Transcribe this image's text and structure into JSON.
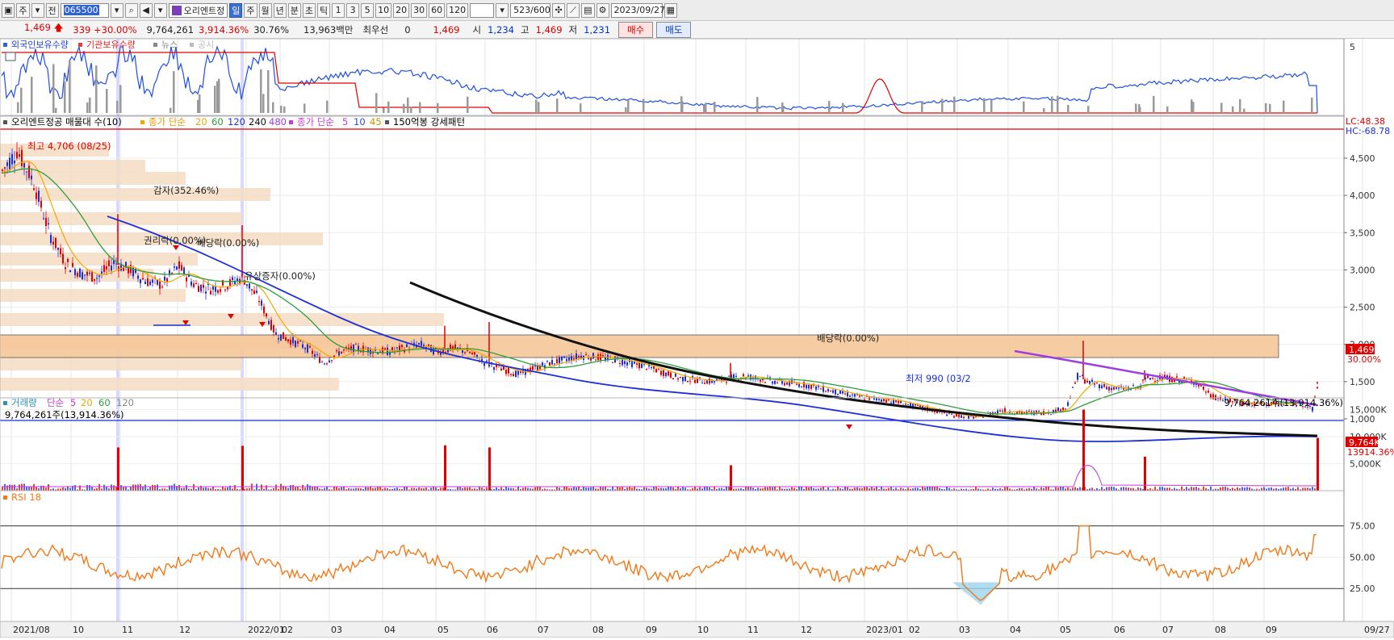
{
  "toolbar": {
    "market_label": "주",
    "period_label": "전",
    "code": "065500",
    "stock_name": "오리엔트정",
    "periods": [
      "일",
      "주",
      "월",
      "년",
      "분",
      "초",
      "틱"
    ],
    "selected_period": "일",
    "intervals": [
      "1",
      "3",
      "5",
      "10",
      "20",
      "30",
      "60",
      "120"
    ],
    "count": "523/600",
    "date": "2023/09/27"
  },
  "info": {
    "price": "1,469",
    "change": "339 +30.00%",
    "volume": "9,764,261",
    "volume_ratio": "3,914.36%",
    "turnover": "30.76%",
    "amount": "13,963백만",
    "priority_label": "최우선",
    "priority_value": "0",
    "priority_price": "1,469",
    "open_label": "시",
    "open": "1,234",
    "high_label": "고",
    "high": "1,469",
    "low_label": "저",
    "low": "1,231",
    "buy_label": "매수",
    "sell_label": "매도"
  },
  "panels": {
    "top_legend": [
      "외국인보유수량",
      "기관보유수량",
      "뉴스",
      "공시"
    ],
    "top_axis": "5",
    "price_legend": {
      "name": "오리엔트정공 매물대 수(10)",
      "ma_close_label": "종가 단순",
      "ma_close": [
        "20",
        "60",
        "120",
        "240",
        "480"
      ],
      "ma_close2_label": "종가 단순",
      "ma_close2": [
        "5",
        "10",
        "45"
      ],
      "pattern": "150억봉 강세패턴"
    },
    "price_axis": [
      "4,500",
      "4,000",
      "3,500",
      "3,000",
      "2,500",
      "2,000",
      "1,500",
      "1,000"
    ],
    "lc_label": "LC:48.38",
    "hc_label": "HC:-68.78",
    "last_price_tag": "1,469",
    "last_pct_tag": "30.00%",
    "annotations": {
      "high": "최고 4,706 (08/25)",
      "low": "최저 990 (03/2",
      "capital_reduction": "감자(352.46%)",
      "rights_drop": "권리락(0.00%)",
      "dividend_drop1": "배당락(0.00%)",
      "paid_in": "유상증자(0.00%)",
      "dividend_drop2": "배당락(0.00%)"
    },
    "volume_legend": {
      "name": "거래량",
      "ma_label": "단순",
      "ma": [
        "5",
        "20",
        "60",
        "120"
      ],
      "left_value": "9,764,261주(13,914.36%)",
      "right_value": "9,764,261주(13,914.36%)"
    },
    "volume_axis": [
      "15,000K",
      "10,000K",
      "5,000K"
    ],
    "volume_tag": "9,764K",
    "volume_tag2": "13914.36%",
    "rsi_legend": "RSI 18",
    "rsi_axis": [
      "75.00",
      "50.00",
      "25.00"
    ],
    "x_axis": [
      "2021/08",
      "10",
      "11",
      "12",
      "2022/01",
      "02",
      "03",
      "04",
      "05",
      "06",
      "07",
      "08",
      "09",
      "10",
      "11",
      "12",
      "2023/01",
      "02",
      "03",
      "04",
      "05",
      "06",
      "07",
      "08",
      "09",
      "09/27"
    ]
  },
  "colors": {
    "up": "#e00000",
    "down": "#1a2ed8",
    "ma20": "#f2a900",
    "ma60": "#2e9c3a",
    "ma120": "#1f2fd6",
    "ma240": "#111111",
    "ma480": "#9b3fe0",
    "rsi": "#f07a1a",
    "volume_profile": "#f5ddc3"
  }
}
